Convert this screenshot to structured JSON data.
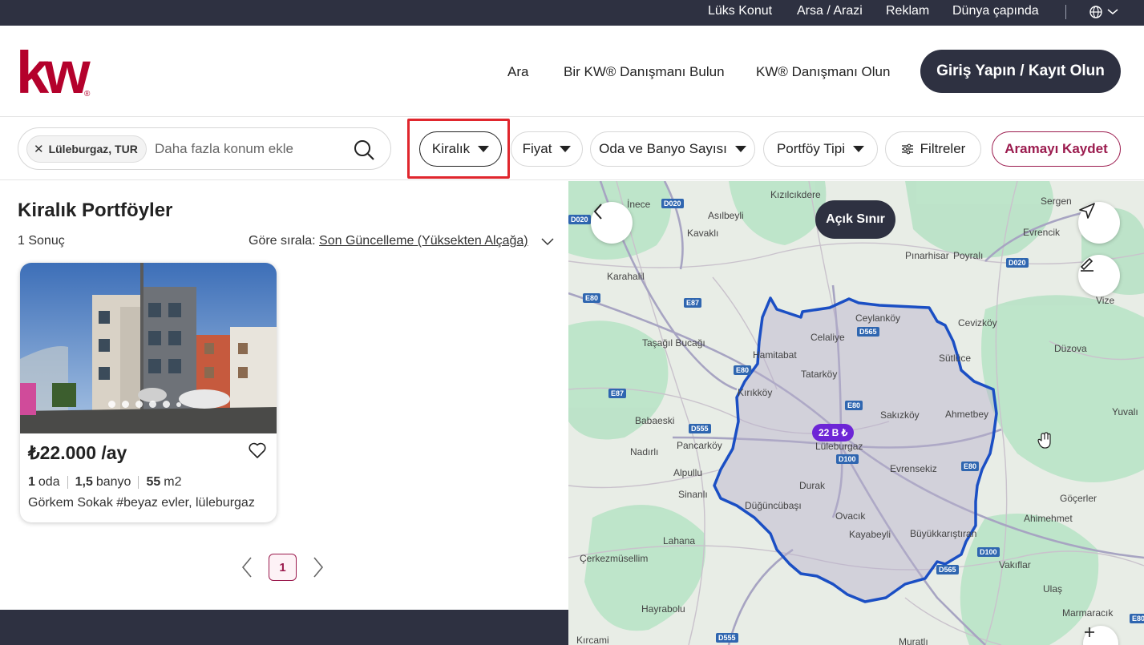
{
  "topbar": {
    "links": [
      "Lüks Konut",
      "Arsa / Arazi",
      "Reklam",
      "Dünya çapında"
    ]
  },
  "header": {
    "logo_text": "kw",
    "nav": [
      "Ara",
      "Bir KW® Danışmanı Bulun",
      "KW® Danışmanı Olun"
    ],
    "login_label": "Giriş Yapın / Kayıt Olun"
  },
  "filters": {
    "location_chip": "Lüleburgaz, TUR",
    "search_placeholder": "Daha fazla konum ekle",
    "listing_type": "Kiralık",
    "price": "Fiyat",
    "rooms": "Oda ve Banyo Sayısı",
    "property_type": "Portföy Tipi",
    "more_filters": "Filtreler",
    "save_search": "Aramayı Kaydet"
  },
  "results": {
    "title": "Kiralık Portföyler",
    "count": "1 Sonuç",
    "sort_label": "Göre sırala:",
    "sort_value": "Son Güncelleme (Yüksekten Alçağa)"
  },
  "listing": {
    "price": "₺22.000 /ay",
    "rooms_value": "1",
    "rooms_unit": "oda",
    "baths_value": "1,5",
    "baths_unit": "banyo",
    "area_value": "55",
    "area_unit": "m2",
    "address": "Görkem Sokak #beyaz evler, lüleburgaz",
    "photo_count": 6
  },
  "pagination": {
    "current": "1"
  },
  "map": {
    "boundary_label": "Açık Sınır",
    "price_marker": "22 B ₺",
    "places": [
      "Kızılcıkdere",
      "İnece",
      "Asılbeyli",
      "Kavaklı",
      "Karahalil",
      "Taşağıl Bucağı",
      "Babaeski",
      "Pancarköy",
      "Nadırlı",
      "Alpullu",
      "Sinanlı",
      "Lahana",
      "Çerkezmüsellim",
      "Hayrabolu",
      "Sergen",
      "Evrencik",
      "Pınarhisar",
      "Poyralı",
      "Vize",
      "Cevizköy",
      "Düzova",
      "Sütlüce",
      "Ceylanköy",
      "Celaliye",
      "Hamitabat",
      "Tatarköy",
      "Kırıkköy",
      "Sakızköy",
      "Ahmetbey",
      "Yuvalı",
      "Lüleburgaz",
      "Evrensekiz",
      "Durak",
      "Düğüncübaşı",
      "Ovacık",
      "Kayabeyli",
      "Büyükkarıştıran",
      "Göçerler",
      "Ahimehmet",
      "Vakıflar",
      "Ulaş",
      "Marmaracık",
      "Muratlı",
      "Kırcami"
    ],
    "roads": [
      "D020",
      "D020",
      "D020",
      "E80",
      "E87",
      "E80",
      "E87",
      "D565",
      "E80",
      "D555",
      "D100",
      "E80",
      "D100",
      "D565",
      "D555",
      "E80"
    ]
  },
  "colors": {
    "dark": "#2e3141",
    "brand_red": "#b4012c",
    "accent": "#9b1b4e",
    "highlight": "#e0262d",
    "boundary": "#1b4fc4",
    "marker": "#6d25d6"
  }
}
